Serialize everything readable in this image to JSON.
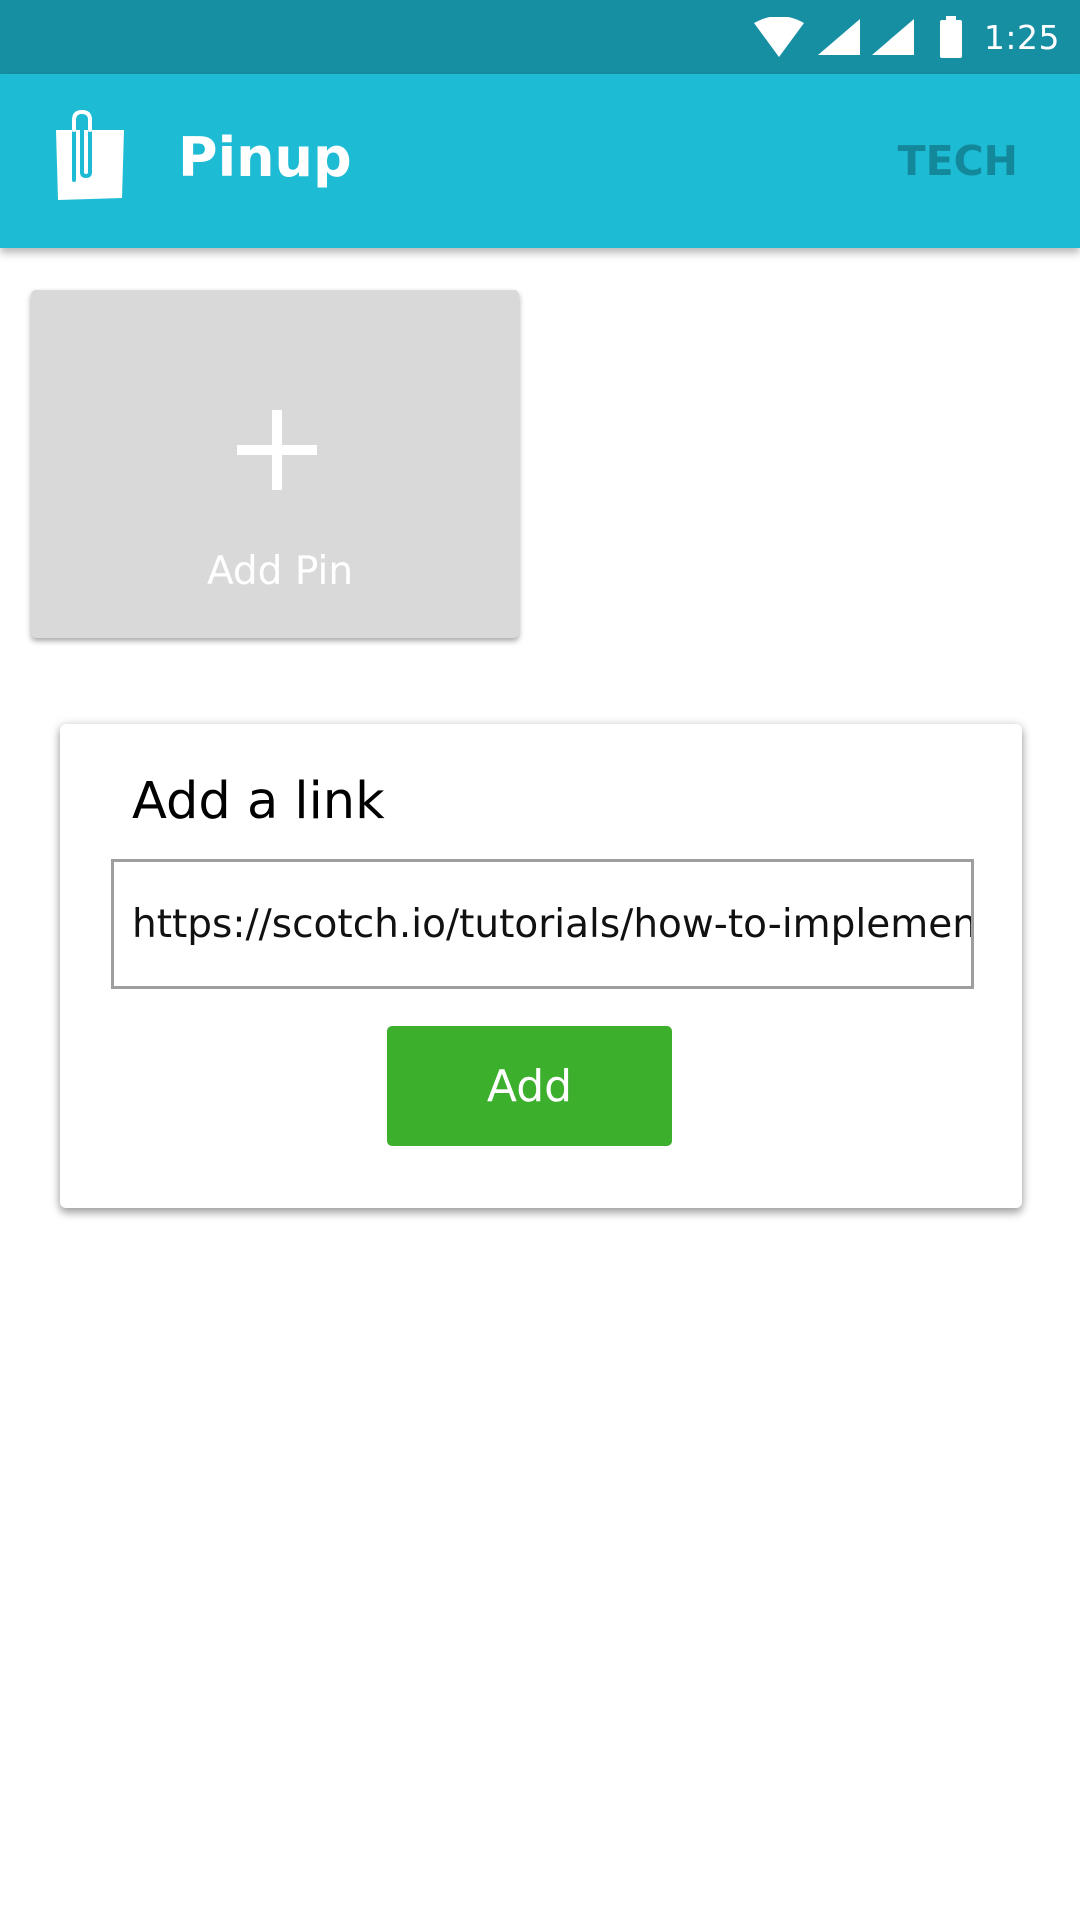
{
  "status_bar": {
    "time": "1:25",
    "icons": [
      "wifi-icon",
      "cell-signal-icon",
      "cell-signal-icon",
      "battery-icon"
    ]
  },
  "app_bar": {
    "title": "Pinup",
    "action_label": "TECH",
    "logo_icon": "paperclip-bag-icon"
  },
  "add_pin": {
    "icon": "plus-icon",
    "label": "Add Pin"
  },
  "add_link_card": {
    "title": "Add a link",
    "url_value": "https://scotch.io/tutorials/how-to-implement-",
    "add_button_label": "Add"
  },
  "colors": {
    "status_bar": "#178fa3",
    "app_bar": "#1dbbd4",
    "action_text": "#13889b",
    "tile": "#d9d9d9",
    "add_button": "#3caf2d"
  }
}
